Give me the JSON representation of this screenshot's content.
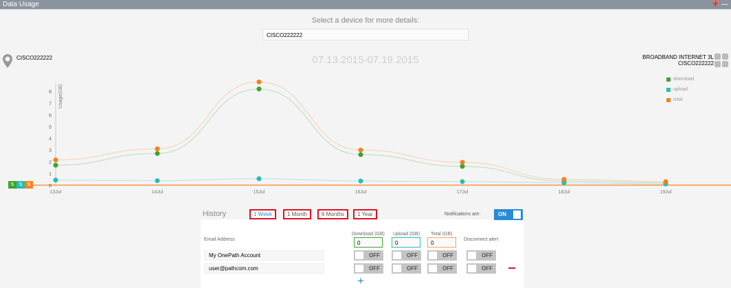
{
  "window": {
    "title": "Data Usage",
    "pin_icon": "pin-icon",
    "minimize_icon": "minimize-icon"
  },
  "device_selector": {
    "label": "Select a device for more details:",
    "value": "CISCO222222"
  },
  "device": {
    "name": "CISCO222222",
    "icon": "location-pin-icon"
  },
  "date_range": "07.13.2015-07.19.2015",
  "service": {
    "plan": "BROADBAND INTERNET 3L",
    "device": "CISCO222222"
  },
  "colors": {
    "download": "#3aa52e",
    "upload": "#26bdb5",
    "total": "#f7801e",
    "accent": "#2b8ad6"
  },
  "chart_data": {
    "type": "line",
    "ylabel": "Usage(GB)",
    "ylim": [
      0,
      8.8
    ],
    "yticks": [
      "0",
      "1",
      "2",
      "3",
      "4",
      "5",
      "6",
      "7",
      "8"
    ],
    "categories": [
      "13Jul",
      "14Jul",
      "15Jul",
      "16Jul",
      "17Jul",
      "18Jul",
      "19Jul"
    ],
    "legend_position": "top-right",
    "series": [
      {
        "name": "download",
        "color": "#3aa52e",
        "values": [
          1.7,
          2.7,
          8.2,
          2.6,
          1.6,
          0.35,
          0.2
        ]
      },
      {
        "name": "upload",
        "color": "#26bdb5",
        "values": [
          0.43,
          0.38,
          0.55,
          0.35,
          0.3,
          0.2,
          0.1
        ]
      },
      {
        "name": "total",
        "color": "#f7801e",
        "values": [
          2.15,
          3.1,
          8.8,
          3.0,
          1.95,
          0.5,
          0.3
        ]
      }
    ]
  },
  "history": {
    "title": "History",
    "ranges": [
      "1 Week",
      "1 Month",
      "6 Months",
      "1 Year"
    ],
    "selected": "1 Week"
  },
  "notifications": {
    "label": "Notifications are:",
    "state": "ON"
  },
  "alerts": {
    "headers": {
      "email": "Email Address",
      "download": "Download (GB)",
      "upload": "Upload (GB)",
      "total": "Total (GB)",
      "disconnect": "Disconnect alert"
    },
    "thresholds": {
      "download": "0",
      "upload": "0",
      "total": "0"
    },
    "rows": [
      {
        "email": "My OnePath Account",
        "download": "OFF",
        "upload": "OFF",
        "total": "OFF",
        "disconnect": "OFF"
      },
      {
        "email": "user@pathcom.com",
        "download": "OFF",
        "upload": "OFF",
        "total": "OFF",
        "disconnect": "OFF"
      }
    ],
    "add_icon": "plus-icon",
    "remove_icon": "minus-icon"
  }
}
